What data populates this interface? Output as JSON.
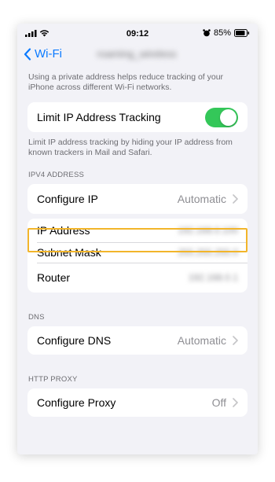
{
  "status_bar": {
    "time": "09:12",
    "battery": "85%",
    "icons": [
      "signal-icon",
      "wifi-icon",
      "alarm-icon",
      "battery-icon"
    ]
  },
  "nav": {
    "back_label": "Wi-Fi",
    "network_name": "roaming_wireless"
  },
  "private_note": "Using a private address helps reduce tracking of your iPhone across different Wi-Fi networks.",
  "limit_tracking": {
    "label": "Limit IP Address Tracking",
    "enabled": true,
    "note": "Limit IP address tracking by hiding your IP address from known trackers in Mail and Safari."
  },
  "ipv4": {
    "header": "IPV4 ADDRESS",
    "configure_label": "Configure IP",
    "configure_value": "Automatic",
    "ip_label": "IP Address",
    "ip_value": "192.168.0.100",
    "subnet_label": "Subnet Mask",
    "subnet_value": "255.255.255.0",
    "router_label": "Router",
    "router_value": "192.168.0.1"
  },
  "dns": {
    "header": "DNS",
    "configure_label": "Configure DNS",
    "configure_value": "Automatic"
  },
  "proxy": {
    "header": "HTTP PROXY",
    "configure_label": "Configure Proxy",
    "configure_value": "Off"
  },
  "colors": {
    "accent": "#0a7aff",
    "toggle_on": "#34c759",
    "highlight": "#f2b52a",
    "background": "#f2f2f7"
  }
}
